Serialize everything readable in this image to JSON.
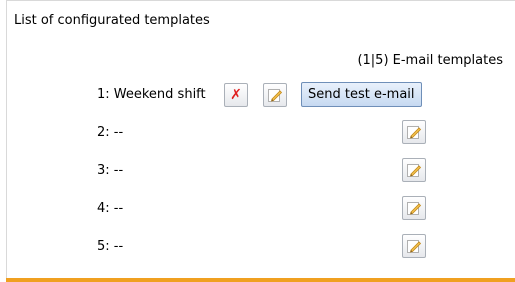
{
  "panel": {
    "title": "List of configurated templates",
    "count_label": "(1|5) E-mail templates"
  },
  "templates": [
    {
      "label": "1: Weekend shift",
      "delete_icon": "delete-x-icon",
      "edit_icon": "pencil-edit-icon",
      "test_button": "Send test e-mail"
    },
    {
      "label": "2: --",
      "edit_icon": "pencil-edit-icon"
    },
    {
      "label": "3: --",
      "edit_icon": "pencil-edit-icon"
    },
    {
      "label": "4: --",
      "edit_icon": "pencil-edit-icon"
    },
    {
      "label": "5: --",
      "edit_icon": "pencil-edit-icon"
    }
  ],
  "colors": {
    "accent_bar": "#f0a020",
    "delete_red": "#e02020",
    "button_blue": "#c6d9f1"
  }
}
